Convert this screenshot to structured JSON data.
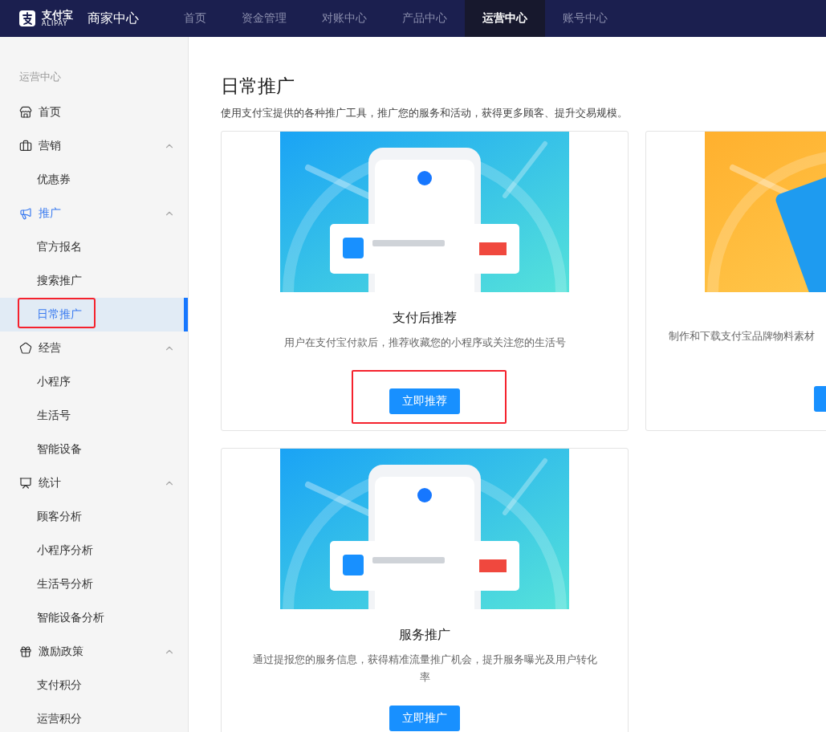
{
  "header": {
    "logo": {
      "name": "支付宝",
      "subtitle": "ALIPAY"
    },
    "app_title": "商家中心",
    "tabs": [
      {
        "label": "首页",
        "selected": false
      },
      {
        "label": "资金管理",
        "selected": false
      },
      {
        "label": "对账中心",
        "selected": false
      },
      {
        "label": "产品中心",
        "selected": false
      },
      {
        "label": "运营中心",
        "selected": true
      },
      {
        "label": "账号中心",
        "selected": false
      }
    ]
  },
  "sidebar": {
    "title": "运营中心",
    "items": [
      {
        "label": "首页",
        "selected": false
      },
      {
        "label": "营销",
        "selected": false,
        "expanded": true,
        "children": [
          {
            "label": "优惠券",
            "selected": false,
            "highlighted": false
          }
        ]
      },
      {
        "label": "推广",
        "selected": true,
        "expanded": true,
        "children": [
          {
            "label": "官方报名",
            "selected": false,
            "highlighted": false
          },
          {
            "label": "搜索推广",
            "selected": false,
            "highlighted": false
          },
          {
            "label": "日常推广",
            "selected": true,
            "highlighted": true
          }
        ]
      },
      {
        "label": "经营",
        "selected": false,
        "expanded": true,
        "children": [
          {
            "label": "小程序",
            "selected": false,
            "highlighted": false
          },
          {
            "label": "生活号",
            "selected": false,
            "highlighted": false
          },
          {
            "label": "智能设备",
            "selected": false,
            "highlighted": false
          }
        ]
      },
      {
        "label": "统计",
        "selected": false,
        "expanded": true,
        "children": [
          {
            "label": "顾客分析",
            "selected": false,
            "highlighted": false
          },
          {
            "label": "小程序分析",
            "selected": false,
            "highlighted": false
          },
          {
            "label": "生活号分析",
            "selected": false,
            "highlighted": false
          },
          {
            "label": "智能设备分析",
            "selected": false,
            "highlighted": false
          }
        ]
      },
      {
        "label": "激励政策",
        "selected": false,
        "expanded": true,
        "children": [
          {
            "label": "支付积分",
            "selected": false,
            "highlighted": false
          },
          {
            "label": "运营积分",
            "selected": false,
            "highlighted": false
          }
        ]
      }
    ]
  },
  "page": {
    "title": "日常推广",
    "description": "使用支付宝提供的各种推广工具，推广您的服务和活动，获得更多顾客、提升交易规模。",
    "cards": [
      {
        "title": "支付后推荐",
        "description": "用户在支付宝付款后，推荐收藏您的小程序或关注您的生活号",
        "has_button": true,
        "button_label": "立即推荐",
        "highlighted": true
      },
      {
        "description": "制作和下载支付宝品牌物料素材",
        "has_button": true,
        "highlighted": false
      },
      {
        "title": "服务推广",
        "description": "通过提报您的服务信息，获得精准流量推广机会，提升服务曝光及用户转化率",
        "has_button": true,
        "button_label": "立即推广",
        "highlighted": false
      }
    ]
  }
}
